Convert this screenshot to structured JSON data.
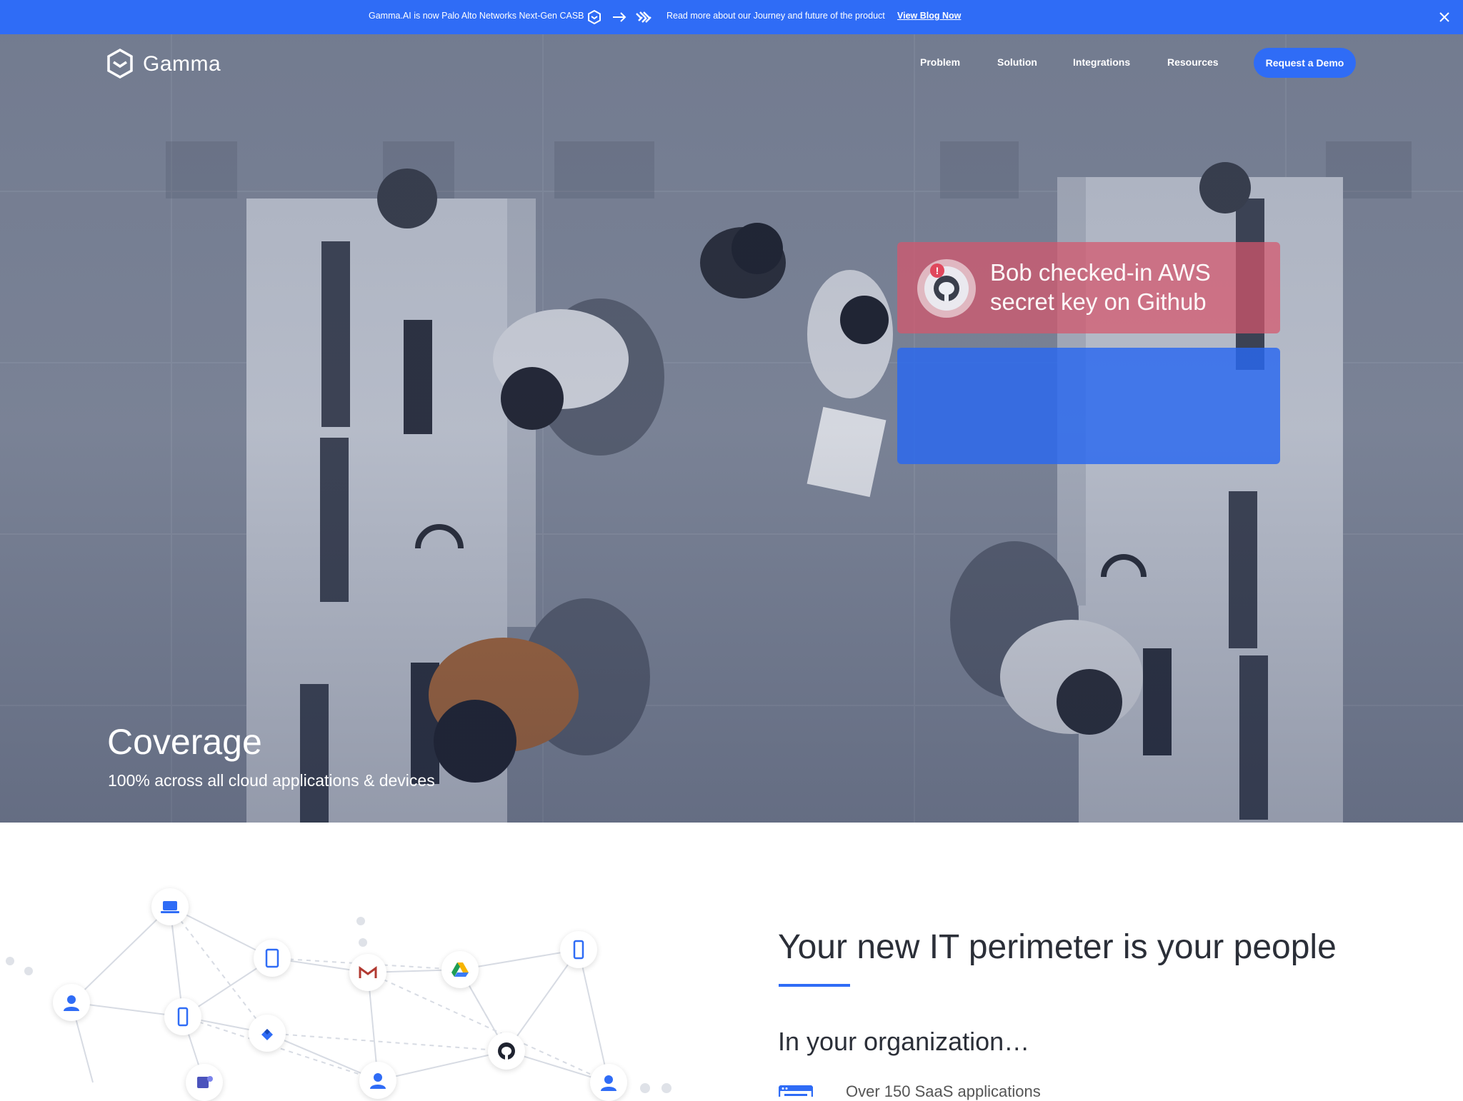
{
  "announcement": {
    "message": "Gamma.AI is now Palo Alto Networks Next-Gen CASB",
    "read_more": "Read more about our Journey and future of the product",
    "link_label": "View Blog Now",
    "icons": [
      "gamma-icon",
      "arrow-right-icon",
      "palo-alto-icon",
      "close-icon"
    ]
  },
  "header": {
    "logo_text": "Gamma",
    "nav": [
      "Problem",
      "Solution",
      "Integrations",
      "Resources"
    ],
    "cta": "Request a Demo"
  },
  "hero": {
    "alert": "Bob checked-in AWS secret key on Github",
    "title": "Coverage",
    "subtitle": "100% across all cloud applications & devices"
  },
  "section": {
    "title": "Your new IT perimeter is your people",
    "subtitle": "In your organization…",
    "item_text": "Over 150 SaaS applications"
  },
  "network_icons": [
    "laptop-icon",
    "tablet-icon",
    "gmail-icon",
    "google-drive-icon",
    "phone-icon",
    "user-icon",
    "jira-icon",
    "github-icon",
    "teams-icon"
  ],
  "colors": {
    "brand_blue": "#2f6cf6",
    "alert_red": "#d6566c",
    "heading_dark": "#2b2f38"
  }
}
